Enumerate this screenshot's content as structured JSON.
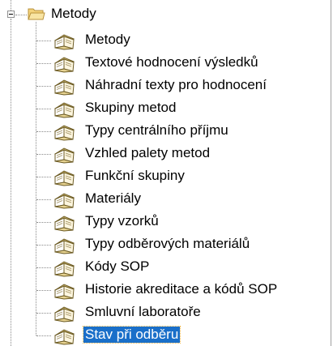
{
  "tree": {
    "root": {
      "label": "Metody",
      "icon": "folder-open-icon",
      "expanded": true
    },
    "items": [
      {
        "label": "Metody",
        "icon": "book-icon"
      },
      {
        "label": "Textové hodnocení výsledků",
        "icon": "book-icon"
      },
      {
        "label": "Náhradní texty pro hodnocení",
        "icon": "book-icon"
      },
      {
        "label": "Skupiny metod",
        "icon": "book-icon"
      },
      {
        "label": "Typy centrálního příjmu",
        "icon": "book-icon"
      },
      {
        "label": "Vzhled palety metod",
        "icon": "book-icon"
      },
      {
        "label": "Funkční skupiny",
        "icon": "book-icon"
      },
      {
        "label": "Materiály",
        "icon": "book-icon"
      },
      {
        "label": "Typy vzorků",
        "icon": "book-icon"
      },
      {
        "label": "Typy odběrových materiálů",
        "icon": "book-icon"
      },
      {
        "label": "Kódy SOP",
        "icon": "book-icon"
      },
      {
        "label": "Historie akreditace a kódů SOP",
        "icon": "book-icon"
      },
      {
        "label": "Smluvní laboratoře",
        "icon": "book-icon"
      },
      {
        "label": "Stav při odběru",
        "icon": "book-icon",
        "selected": true
      }
    ]
  },
  "colors": {
    "selection_background": "#1a6fc9",
    "selection_text": "#ffffff",
    "folder_fill": "#f3d27a",
    "book_cover": "#e6d291",
    "book_pages": "#ffffff",
    "tree_lines": "#8a8a8a"
  }
}
